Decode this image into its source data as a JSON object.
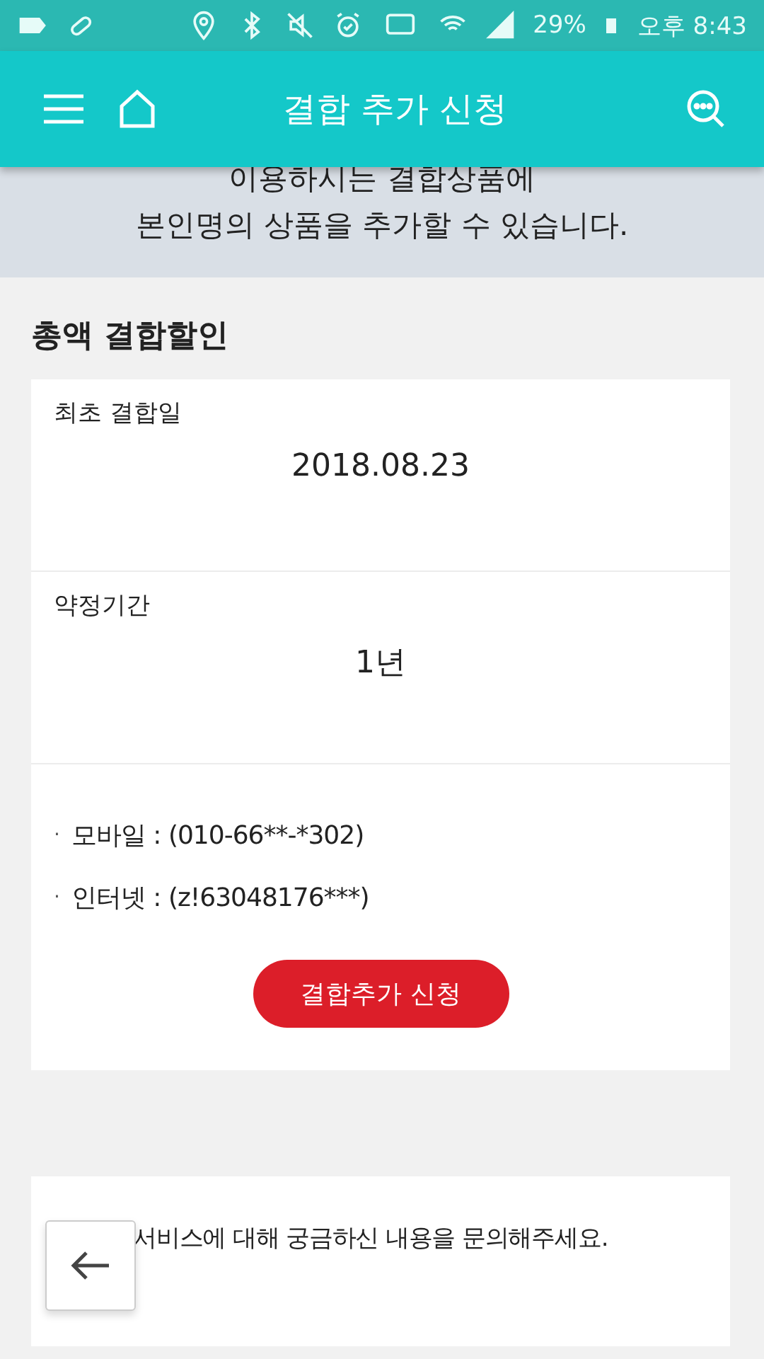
{
  "status_bar": {
    "battery": "29%",
    "time": "오후 8:43"
  },
  "header": {
    "title": "결합 추가 신청"
  },
  "banner": {
    "lines": [
      "이용하시는 결합상품에",
      "본인명의 상품을 추가할 수 있습니다."
    ]
  },
  "section": {
    "title": "총액 결합할인",
    "fields": [
      {
        "label": "최초 결합일",
        "value": "2018.08.23"
      },
      {
        "label": "약정기간",
        "value": "1년"
      }
    ],
    "items": [
      {
        "bullet": "·",
        "text": "모바일 : (010-66**-*302)"
      },
      {
        "bullet": "·",
        "text": "인터넷 : (z!63048176***)"
      }
    ],
    "button": "결합추가 신청"
  },
  "inquiry": {
    "text": "서비스에 대해 궁금하신 내용을 문의해주세요."
  }
}
